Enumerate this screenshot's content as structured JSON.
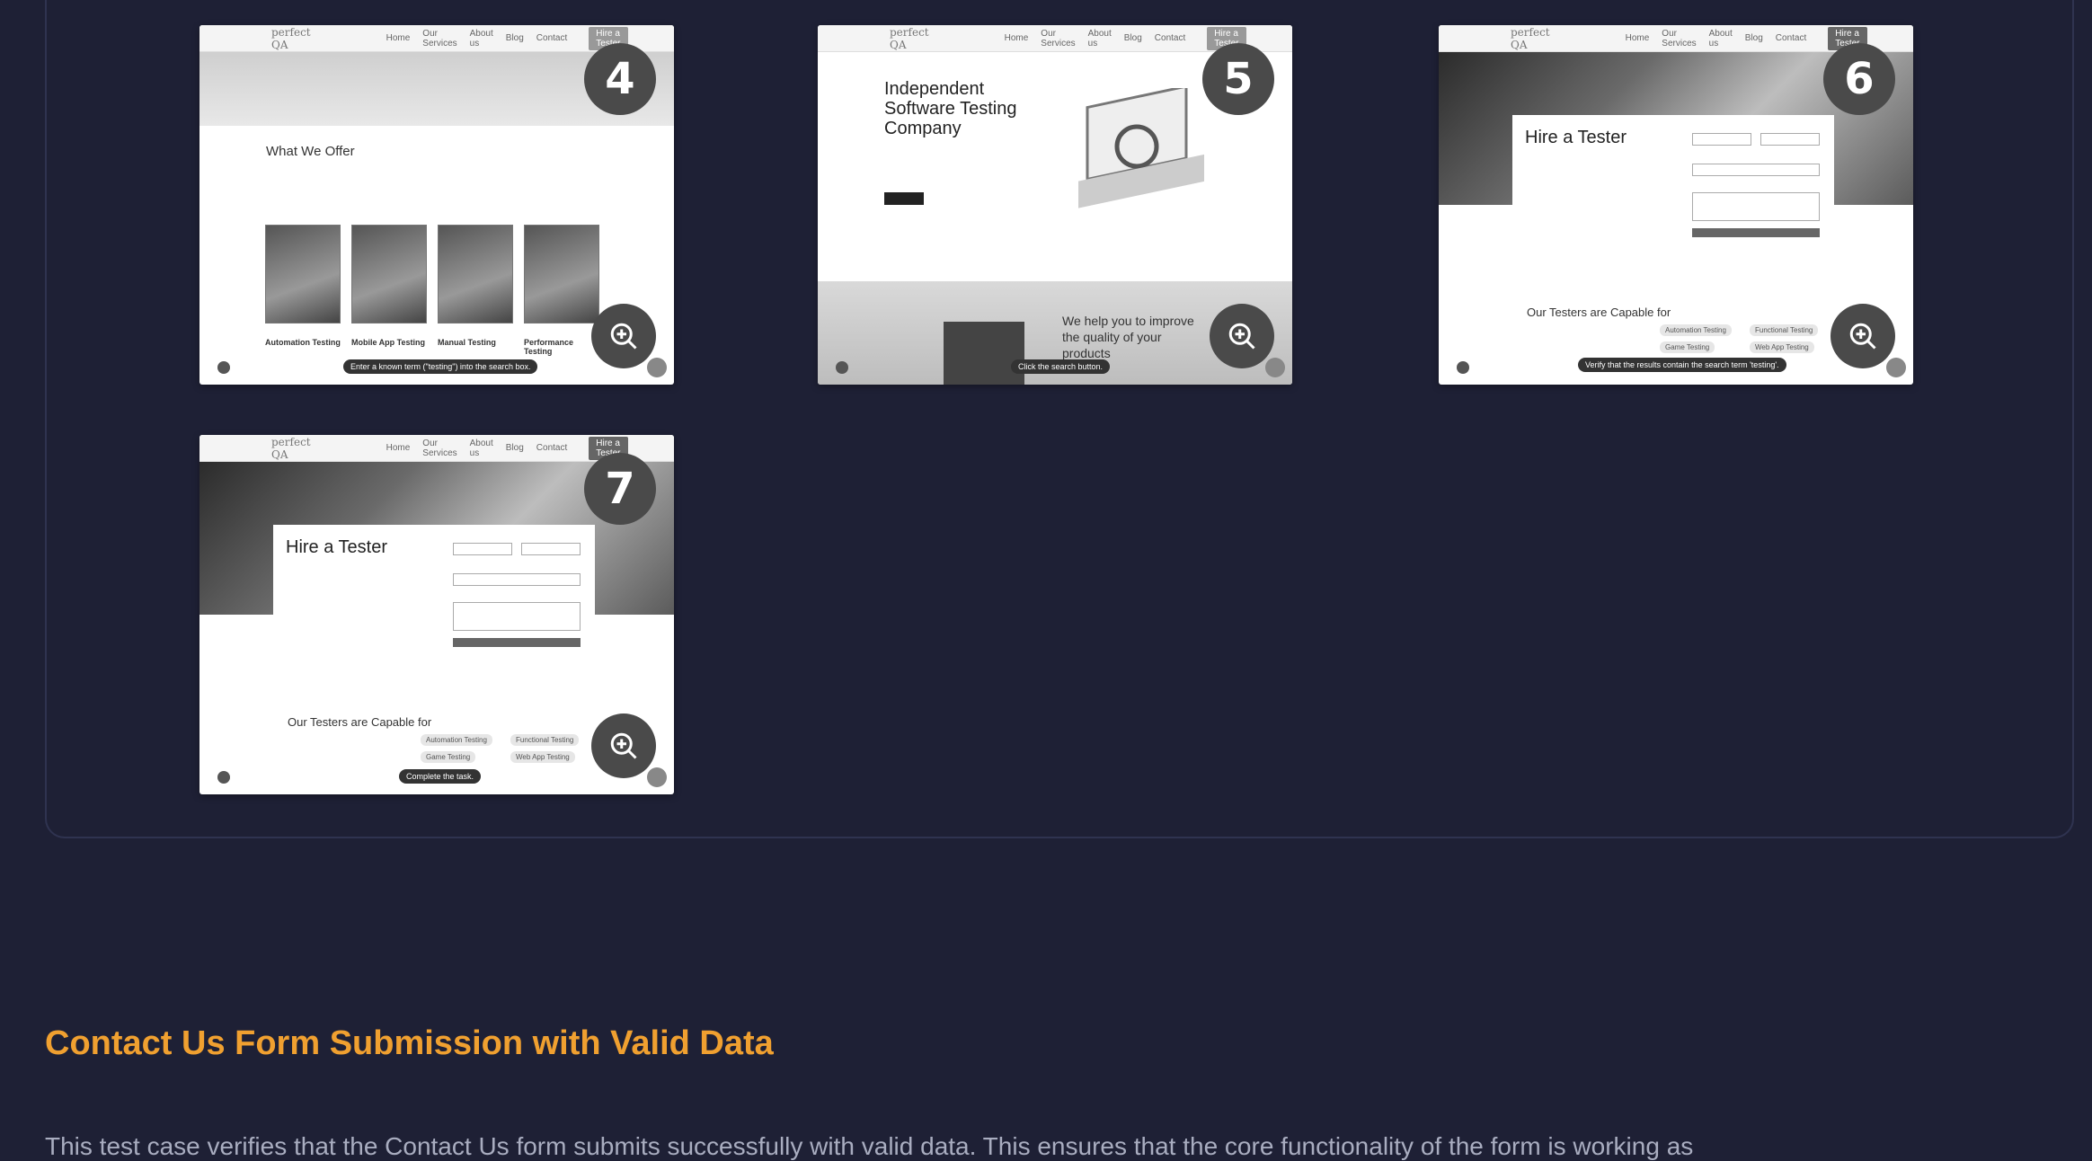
{
  "cards": [
    {
      "number": "4",
      "logo": "perfect QA",
      "heading": "What We Offer",
      "items": [
        "Automation Testing",
        "Mobile App Testing",
        "Manual Testing",
        "Performance Testing"
      ],
      "tooltip": "Enter a known term (\"testing\") into the search box."
    },
    {
      "number": "5",
      "logo": "perfect QA",
      "heading": "Independent Software Testing Company",
      "bottom_text": "We help you to improve the quality of your products",
      "tooltip": "Click the search button."
    },
    {
      "number": "6",
      "logo": "perfect QA",
      "heading": "Hire a Tester",
      "capable": "Our Testers are Capable for",
      "tooltip": "Verify that the results contain the search term 'testing'."
    },
    {
      "number": "7",
      "logo": "perfect QA",
      "heading": "Hire a Tester",
      "capable": "Our Testers are Capable for",
      "tooltip": "Complete the task."
    }
  ],
  "section": {
    "title": "Contact Us Form Submission with Valid Data",
    "description": "This test case verifies that the Contact Us form submits successfully with valid data. This ensures that the core functionality of the form is working as"
  },
  "colors": {
    "background": "#1e2035",
    "accent_title": "#f0a030",
    "selected_border": "#5cc05c"
  },
  "icons": {
    "zoom": "zoom-in-icon",
    "chat": "chat-icon"
  }
}
